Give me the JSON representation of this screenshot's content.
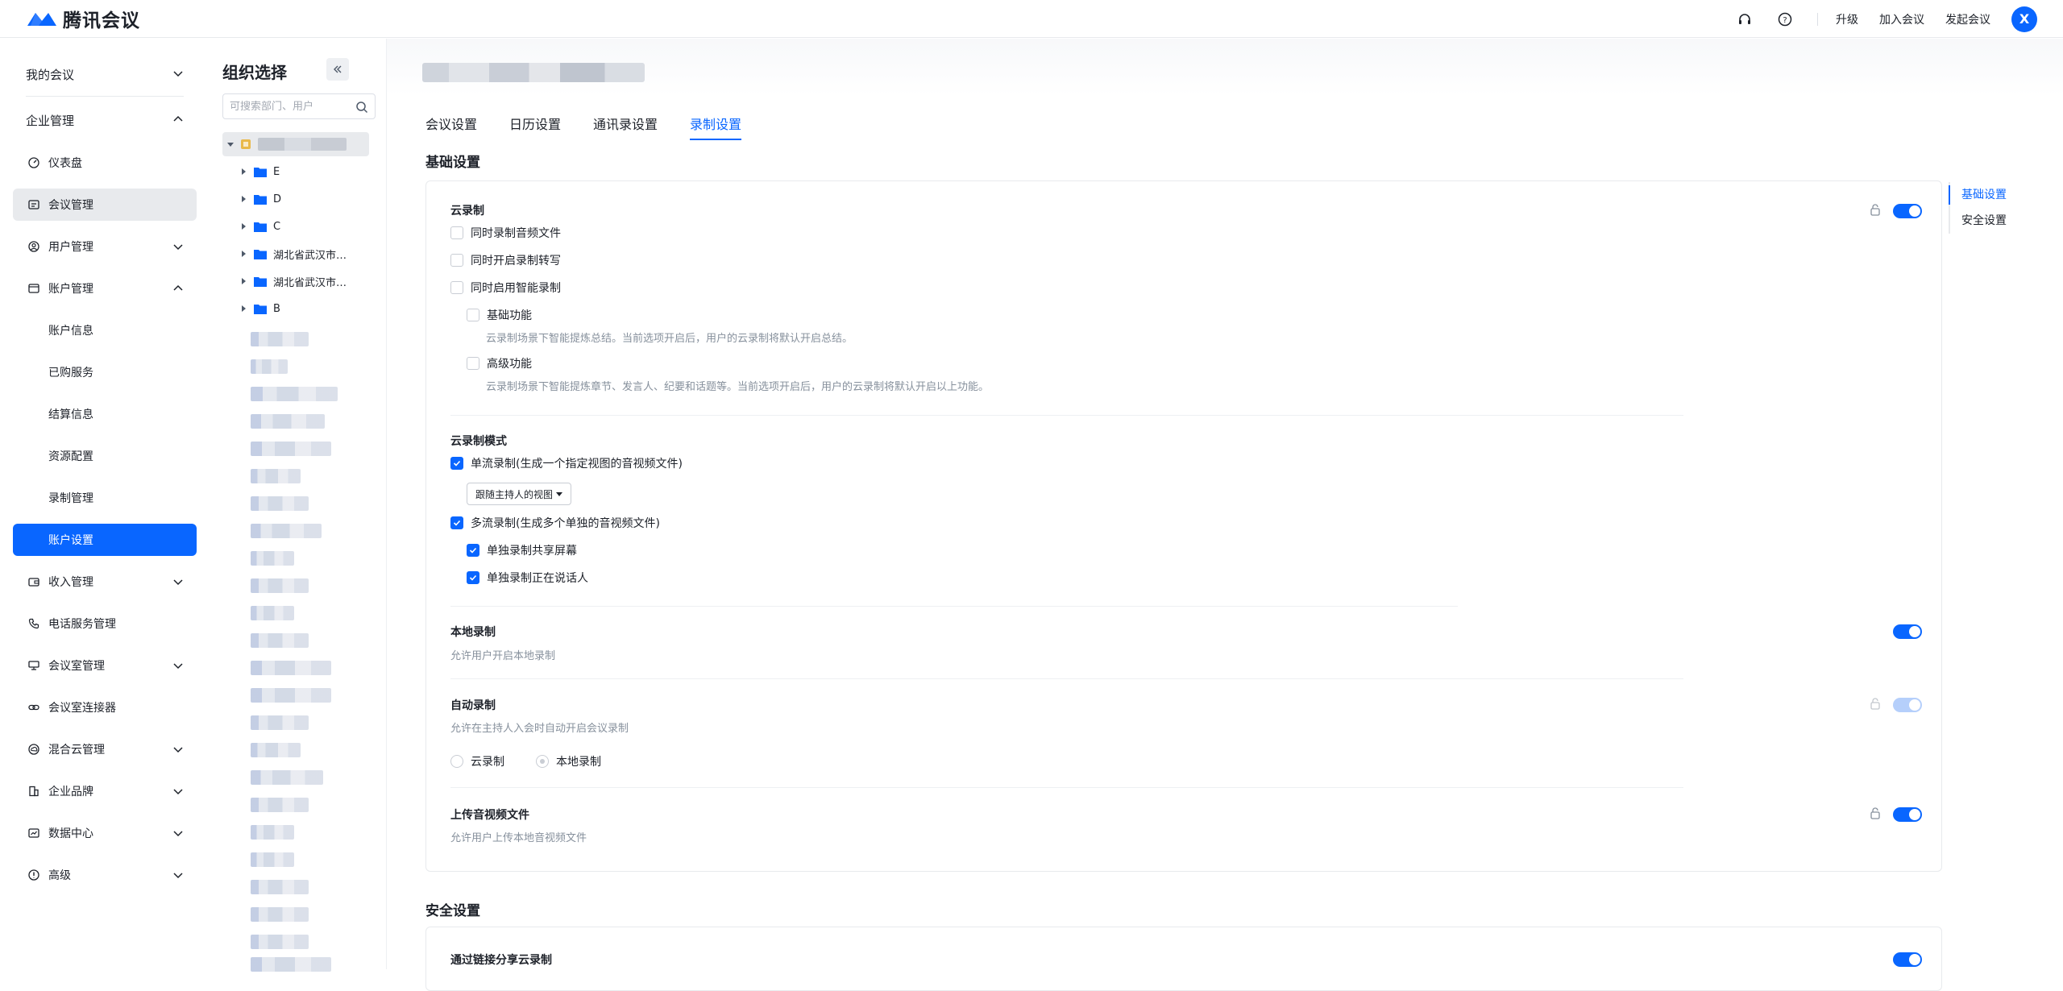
{
  "app": {
    "name": "腾讯会议",
    "brand_color": "#0966ff"
  },
  "topbar": {
    "support_icon": "headset-icon",
    "help_icon": "help-icon",
    "upgrade": "升级",
    "join": "加入会议",
    "start": "发起会议",
    "avatar_letter": "X"
  },
  "nav": {
    "my_meetings": "我的会议",
    "enterprise": "企业管理",
    "dashboard": "仪表盘",
    "meeting_mgmt": "会议管理",
    "user_mgmt": "用户管理",
    "account_mgmt": "账户管理",
    "account_info": "账户信息",
    "purchased": "已购服务",
    "billing": "结算信息",
    "resources": "资源配置",
    "recording_mgmt": "录制管理",
    "account_settings": "账户设置",
    "income": "收入管理",
    "phone": "电话服务管理",
    "rooms": "会议室管理",
    "room_connector": "会议室连接器",
    "hybrid_cloud": "混合云管理",
    "brand": "企业品牌",
    "data_center": "数据中心",
    "advanced": "高级"
  },
  "org": {
    "title": "组织选择",
    "search_placeholder": "可搜索部门、用户",
    "folders": [
      "E",
      "D",
      "C",
      "湖北省武汉市…",
      "湖北省武汉市…",
      "B"
    ]
  },
  "tabs": [
    "会议设置",
    "日历设置",
    "通讯录设置",
    "录制设置"
  ],
  "basic": {
    "title": "基础设置",
    "cloud": {
      "title": "云录制",
      "opt_audio": "同时录制音频文件",
      "opt_transcript": "同时开启录制转写",
      "opt_smart": "同时启用智能录制",
      "basic_fn": "基础功能",
      "basic_desc": "云录制场景下智能提炼总结。当前选项开启后，用户的云录制将默认开启总结。",
      "adv_fn": "高级功能",
      "adv_desc": "云录制场景下智能提炼章节、发言人、纪要和话题等。当前选项开启后，用户的云录制将默认开启以上功能。"
    },
    "mode": {
      "title": "云录制模式",
      "single": "单流录制(生成一个指定视图的音视频文件)",
      "view_select": "跟随主持人的视图",
      "multi": "多流录制(生成多个单独的音视频文件)",
      "multi_share": "单独录制共享屏幕",
      "multi_speaker": "单独录制正在说话人"
    },
    "local": {
      "title": "本地录制",
      "desc": "允许用户开启本地录制"
    },
    "auto": {
      "title": "自动录制",
      "desc": "允许在主持人入会时自动开启会议录制",
      "opt_cloud": "云录制",
      "opt_local": "本地录制"
    },
    "upload": {
      "title": "上传音视频文件",
      "desc": "允许用户上传本地音视频文件"
    }
  },
  "security": {
    "title": "安全设置",
    "share_link": "通过链接分享云录制"
  },
  "anchor": [
    "基础设置",
    "安全设置"
  ]
}
